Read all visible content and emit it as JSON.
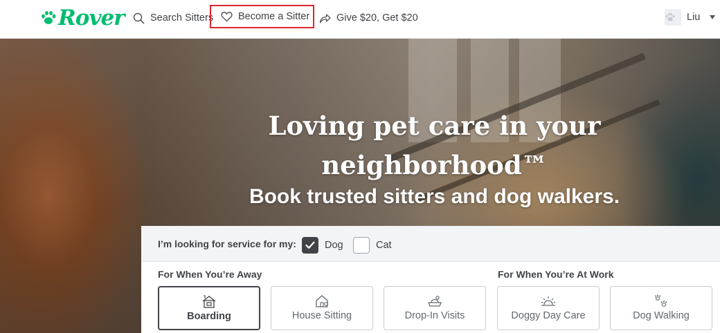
{
  "brand": {
    "name": "Rover",
    "color": "#00bd70"
  },
  "nav": {
    "search_label": "Search Sitters",
    "become_label": "Become a Sitter",
    "give_label": "Give $20, Get $20",
    "user_name": "Liu",
    "icons": {
      "search": "search-icon",
      "become": "heart-icon",
      "give": "share-arrow-icon",
      "avatar": "paw-icon",
      "menu": "caret-down-icon"
    },
    "highlight_color": "#d9272e"
  },
  "hero": {
    "title_line1": "Loving pet care in your",
    "title_line2": "neighborhood™",
    "subtitle": "Book trusted sitters and dog walkers."
  },
  "search": {
    "pet_prompt": "I’m looking for service for my:",
    "pets": [
      {
        "label": "Dog",
        "checked": true
      },
      {
        "label": "Cat",
        "checked": false
      }
    ],
    "away_label": "For When You’re Away",
    "work_label": "For When You’re At Work",
    "services": [
      {
        "label": "Boarding",
        "icon": "house-boarding-icon",
        "selected": true
      },
      {
        "label": "House Sitting",
        "icon": "house-sitting-icon",
        "selected": false
      },
      {
        "label": "Drop-In Visits",
        "icon": "food-bowl-icon",
        "selected": false
      },
      {
        "label": "Doggy Day Care",
        "icon": "sunrise-icon",
        "selected": false
      },
      {
        "label": "Dog Walking",
        "icon": "paw-prints-icon",
        "selected": false
      }
    ]
  }
}
